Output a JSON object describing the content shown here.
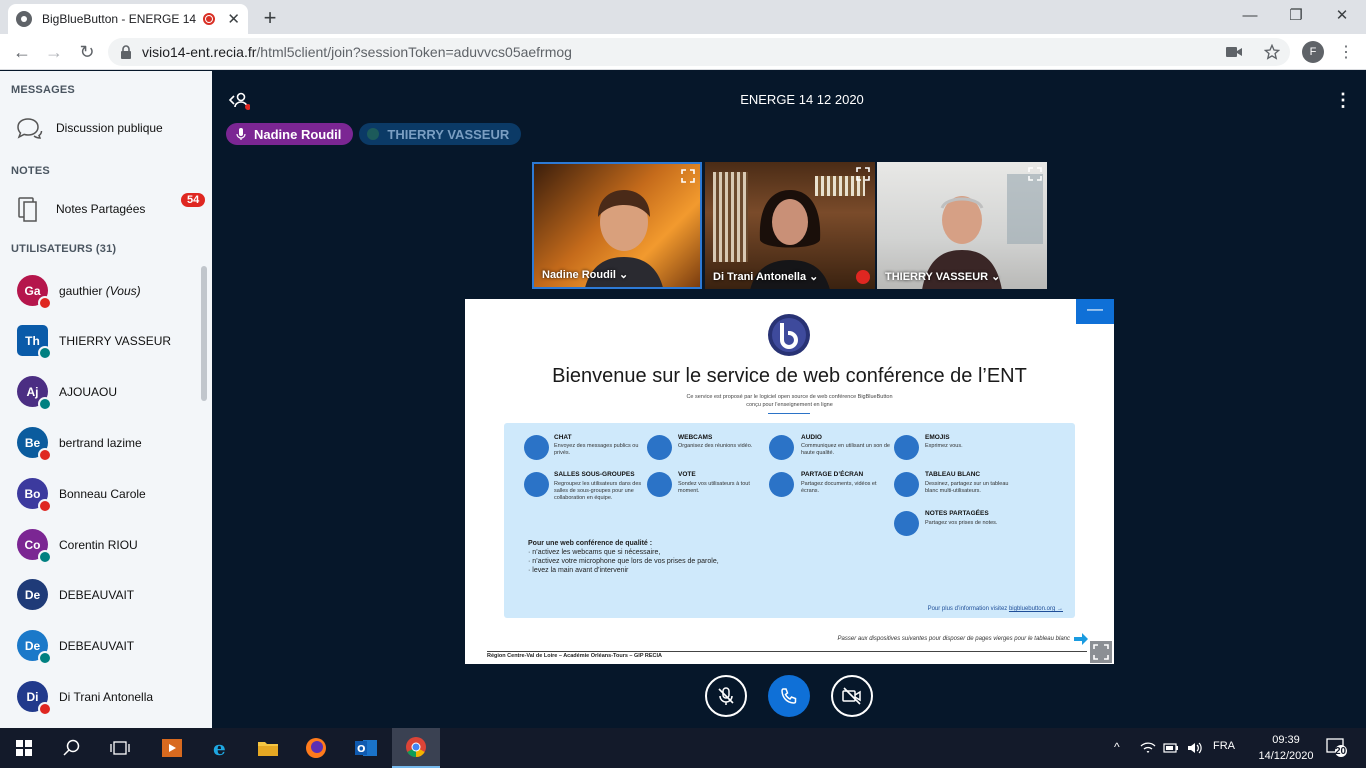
{
  "browser": {
    "tab_title": "BigBlueButton - ENERGE 14",
    "url_host": "visio14-ent.recia.fr",
    "url_path": "/html5client/join?sessionToken=aduvvcs05aefrmog",
    "profile_initial": "F"
  },
  "sidebar": {
    "messages_header": "MESSAGES",
    "public_chat_label": "Discussion publique",
    "public_chat_count": "54",
    "notes_header": "NOTES",
    "shared_notes_label": "Notes Partagées",
    "users_header": "UTILISATEURS (31)",
    "you_suffix": "(Vous)",
    "users": [
      {
        "initials": "Ga",
        "name": "gauthier",
        "color": "#b5164c",
        "status": "muted"
      },
      {
        "initials": "Th",
        "name": "THIERRY VASSEUR",
        "color": "#0a5ba9",
        "status": "mic"
      },
      {
        "initials": "Aj",
        "name": "AJOUAOU",
        "color": "#4b2e83",
        "status": "listen"
      },
      {
        "initials": "Be",
        "name": "bertrand lazime",
        "color": "#0b5c9e",
        "status": "muted"
      },
      {
        "initials": "Bo",
        "name": "Bonneau Carole",
        "color": "#3c3a9e",
        "status": "muted"
      },
      {
        "initials": "Co",
        "name": "Corentin RIOU",
        "color": "#7b2693",
        "status": "listen"
      },
      {
        "initials": "De",
        "name": "DEBEAUVAIT",
        "color": "#1f3b78",
        "status": "none"
      },
      {
        "initials": "De",
        "name": "DEBEAUVAIT",
        "color": "#1b79c9",
        "status": "listen"
      },
      {
        "initials": "Di",
        "name": "Di Trani Antonella",
        "color": "#213a8c",
        "status": "muted"
      }
    ]
  },
  "meeting": {
    "title": "ENERGE 14 12 2020",
    "talkers": [
      {
        "name": "Nadine Roudil",
        "active": true
      },
      {
        "name": "THIERRY VASSEUR",
        "active": false
      }
    ]
  },
  "videos": [
    {
      "name": "Nadine Roudil"
    },
    {
      "name": "Di Trani Antonella"
    },
    {
      "name": "THIERRY VASSEUR"
    }
  ],
  "slide": {
    "heading": "Bienvenue sur le service de web conférence de l’ENT",
    "sub1": "Ce service est proposé par le logiciel open source de web conférence BigBlueButton",
    "sub2": "conçu pour l’enseignement en ligne",
    "features": [
      {
        "title": "CHAT",
        "desc": "Envoyez des messages publics ou privés."
      },
      {
        "title": "WEBCAMS",
        "desc": "Organisez des réunions vidéo."
      },
      {
        "title": "AUDIO",
        "desc": "Communiquez en utilisant un son de haute qualité."
      },
      {
        "title": "EMOJIS",
        "desc": "Exprimez vous."
      },
      {
        "title": "SALLES SOUS-GROUPES",
        "desc": "Regroupez les utilisateurs dans des salles de sous-groupes pour une collaboration en équipe."
      },
      {
        "title": "VOTE",
        "desc": "Sondez vos utilisateurs à tout moment."
      },
      {
        "title": "PARTAGE D’ÉCRAN",
        "desc": "Partagez documents, vidéos et écrans."
      },
      {
        "title": "TABLEAU BLANC",
        "desc": "Dessinez, partagez sur un tableau blanc multi-utilisateurs."
      },
      {
        "title": "NOTES PARTAGÉES",
        "desc": "Partagez vos prises de notes."
      }
    ],
    "quality_title": "Pour une web conférence de qualité :",
    "quality_items": [
      "n’activez les webcams que si nécessaire,",
      "n’activez votre microphone que lors de vos prises de parole,",
      "levez la main avant d’intervenir"
    ],
    "more_info": "Pour plus d’information visitez",
    "more_link": "bigbluebutton.org →",
    "next_hint": "Passer aux dispositives suivantes pour disposer de pages vierges pour le tableau blanc",
    "footer": "Région Centre-Val de Loire – Académie Orléans-Tours – GIP RECIA"
  },
  "taskbar": {
    "lang": "FRA",
    "time": "09:39",
    "date": "14/12/2020",
    "notif_count": "20"
  },
  "colors": {
    "bbb_blue": "#0f70d7",
    "muted_red": "#df2721",
    "mic_green": "#008081",
    "talker_purple": "#7b2693"
  }
}
